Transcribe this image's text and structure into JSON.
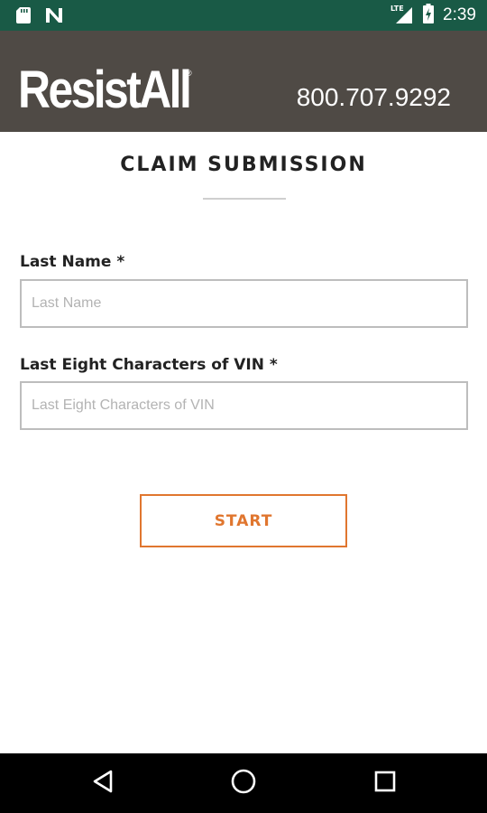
{
  "status_bar": {
    "time": "2:39",
    "network": "LTE",
    "icons": [
      "sd-card-icon",
      "n-notification-icon",
      "lte-signal-icon",
      "battery-charging-icon"
    ]
  },
  "header": {
    "logo_text": "ResistAll",
    "logo_mark": "®",
    "phone": "800.707.9292",
    "background_color": "#4f4a45"
  },
  "page": {
    "title": "CLAIM SUBMISSION"
  },
  "form": {
    "last_name": {
      "label": "Last Name *",
      "placeholder": "Last Name",
      "value": ""
    },
    "vin": {
      "label": "Last Eight Characters of VIN *",
      "placeholder": "Last Eight Characters of VIN",
      "value": ""
    },
    "start_label": "START"
  },
  "colors": {
    "status_bar": "#195a46",
    "accent": "#e0762f"
  },
  "nav_bar": {
    "icons": [
      "back-icon",
      "home-icon",
      "recents-icon"
    ]
  }
}
